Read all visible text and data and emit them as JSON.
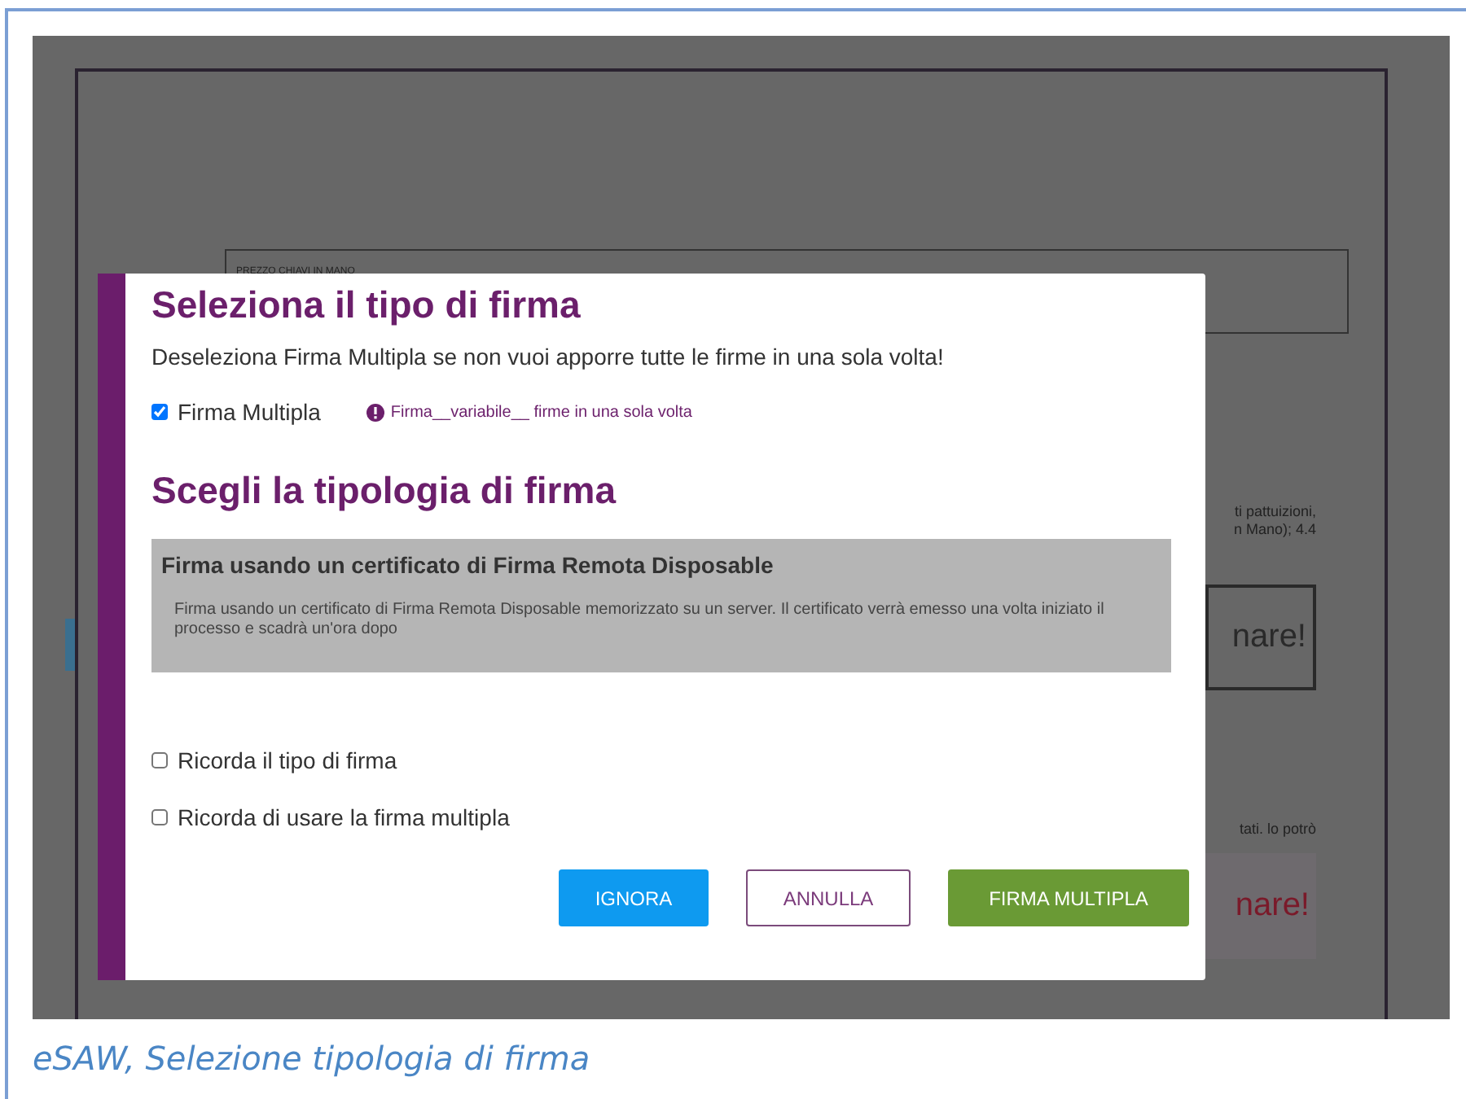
{
  "background_document": {
    "price_box_label": "PREZZO CHIAVI IN MANO",
    "fragment_1": "ti pattuizioni,",
    "fragment_2": "n Mano); 4.4",
    "button_1": "nare!",
    "fragment_3": "tati. lo potrò",
    "button_2": "nare!"
  },
  "dialog": {
    "title": "Seleziona il tipo di firma",
    "subtitle": "Deseleziona Firma Multipla se non vuoi apporre tutte le firme in una sola volta!",
    "multiple_signature": {
      "label": "Firma Multipla",
      "checked": true
    },
    "info": "Firma__variabile__ firme in una sola volta",
    "section_title": "Scegli la tipologia di firma",
    "options": [
      {
        "title": "Firma usando un certificato di Firma Remota Disposable",
        "description": "Firma usando un certificato di Firma Remota Disposable memorizzato su un server. Il certificato verrà emesso una volta iniziato il processo e scadrà un'ora dopo",
        "selected": true
      }
    ],
    "remember": [
      {
        "label": "Ricorda il tipo di firma",
        "checked": false
      },
      {
        "label": "Ricorda di usare la firma multipla",
        "checked": false
      }
    ],
    "buttons": [
      {
        "label": "IGNORA",
        "kind": "info"
      },
      {
        "label": "ANNULLA",
        "kind": "outline"
      },
      {
        "label": "FIRMA MULTIPLA",
        "kind": "success"
      }
    ]
  },
  "caption": "eSAW, Selezione tipologia di firma"
}
